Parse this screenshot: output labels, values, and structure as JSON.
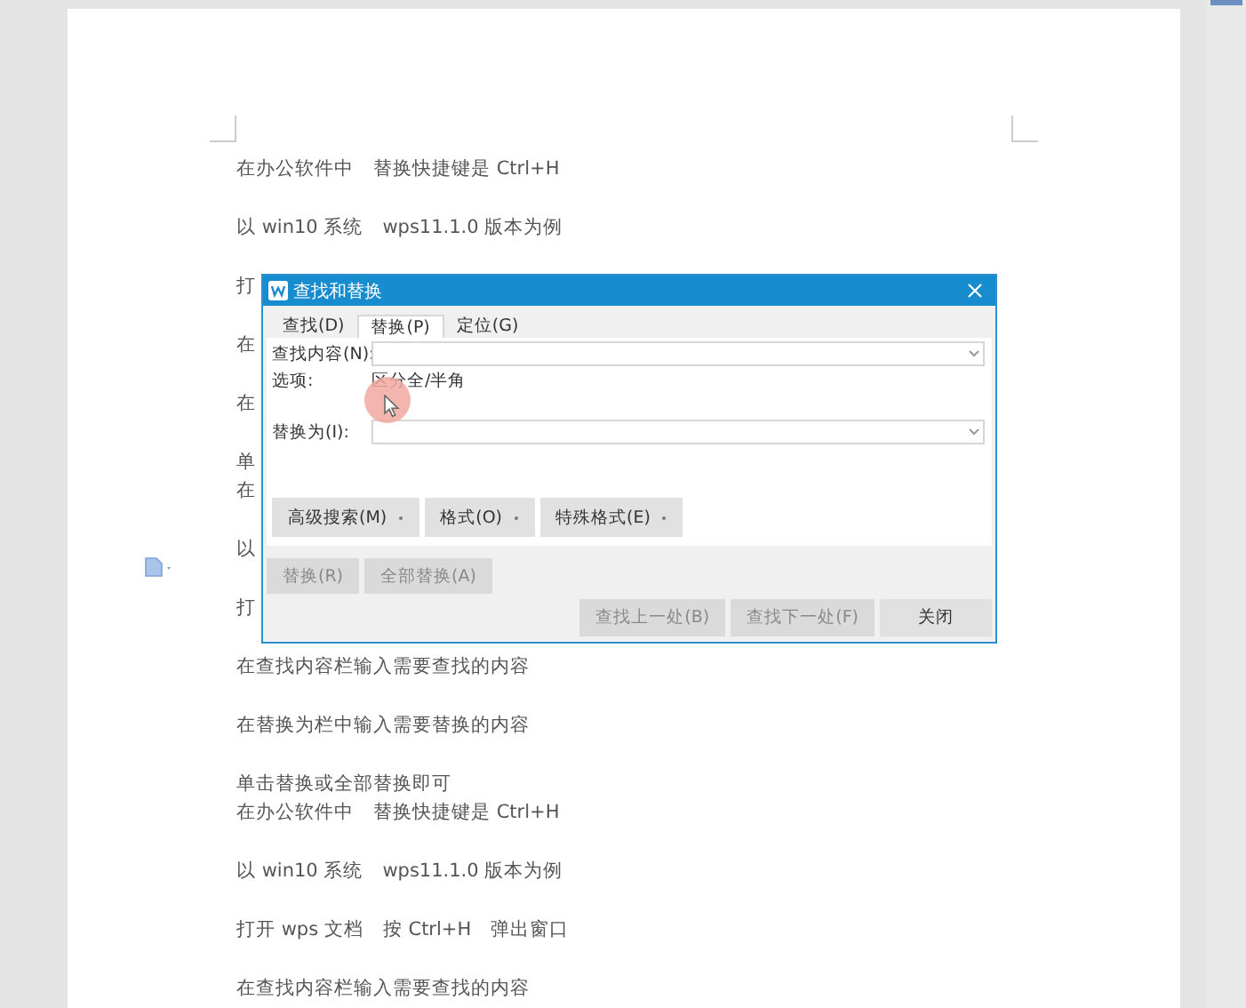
{
  "document": {
    "paragraphs": [
      {
        "lines": [
          "在办公软件中　替换快捷键是 Ctrl+H"
        ]
      },
      {
        "lines": [
          "以 win10 系统　wps11.1.0 版本为例"
        ]
      },
      {
        "lines": [
          "打"
        ]
      },
      {
        "lines": [
          "在"
        ]
      },
      {
        "lines": [
          "在"
        ]
      },
      {
        "lines": [
          "单",
          "在"
        ]
      },
      {
        "lines": [
          "以"
        ]
      },
      {
        "lines": [
          "打"
        ]
      },
      {
        "lines": [
          "在查找内容栏输入需要查找的内容"
        ]
      },
      {
        "lines": [
          "在替换为栏中输入需要替换的内容"
        ]
      },
      {
        "lines": [
          "单击替换或全部替换即可",
          "在办公软件中　替换快捷键是 Ctrl+H"
        ]
      },
      {
        "lines": [
          "以 win10 系统　wps11.1.0 版本为例"
        ]
      },
      {
        "lines": [
          "打开 wps 文档　按 Ctrl+H　弹出窗口"
        ]
      },
      {
        "lines": [
          "在查找内容栏输入需要查找的内容"
        ]
      }
    ]
  },
  "dialog": {
    "title": "查找和替换",
    "tabs": [
      {
        "label": "查找(D)",
        "selected": false
      },
      {
        "label": "替换(P)",
        "selected": true
      },
      {
        "label": "定位(G)",
        "selected": false
      }
    ],
    "find_label": "查找内容(N):",
    "options_label": "选项:",
    "options_value": "区分全/半角",
    "replace_label": "替换为(I):",
    "menu_buttons": [
      {
        "label": "高级搜索(M)"
      },
      {
        "label": "格式(O)"
      },
      {
        "label": "特殊格式(E)"
      }
    ],
    "replace_buttons": [
      {
        "label": "替换(R)",
        "disabled": true
      },
      {
        "label": "全部替换(A)",
        "disabled": true
      }
    ],
    "bottom_buttons": [
      {
        "label": "查找上一处(B)",
        "disabled": true
      },
      {
        "label": "查找下一处(F)",
        "disabled": true
      },
      {
        "label": "关闭",
        "disabled": false
      }
    ]
  }
}
